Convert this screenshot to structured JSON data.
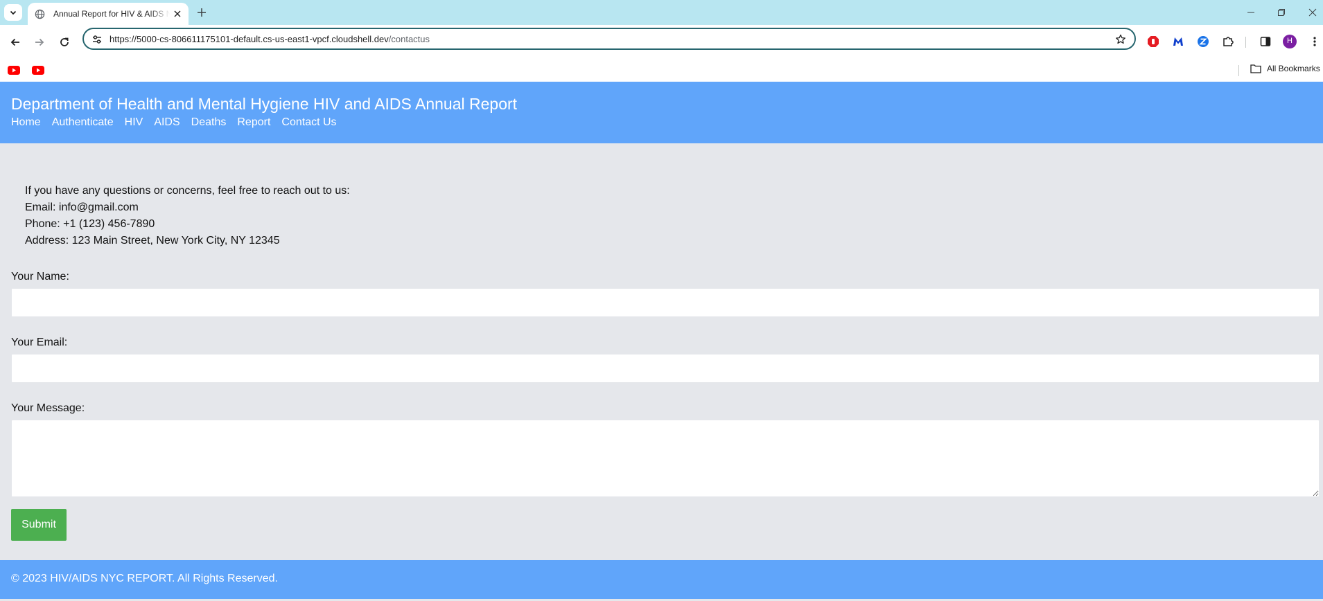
{
  "browser": {
    "tab_title": "Annual Report for HIV & AIDS NYC",
    "url_host": "https://5000-cs-806611175101-default.cs-us-east1-vpcf.cloudshell.dev",
    "url_path": "/contactus",
    "profile_initial": "H",
    "bookmarks_label": "All Bookmarks",
    "icons": {
      "tab_menu": "chevron-down-icon",
      "favicon": "globe-icon",
      "tab_close": "close-icon",
      "new_tab": "plus-icon",
      "back": "arrow-left-icon",
      "forward": "arrow-right-icon",
      "reload": "reload-icon",
      "site_info": "tune-icon",
      "bookmark": "star-icon",
      "extensions": [
        "adblock-icon",
        "malwarebytes-icon",
        "zoom-icon",
        "puzzle-icon"
      ],
      "side_panel": "side-panel-icon",
      "menu": "kebab-menu-icon",
      "bookmark_items": [
        "youtube-icon",
        "youtube-icon"
      ],
      "bookmarks_folder": "folder-icon"
    }
  },
  "site": {
    "title": "Department of Health and Mental Hygiene HIV and AIDS Annual Report",
    "nav": [
      "Home",
      "Authenticate",
      "HIV",
      "AIDS",
      "Deaths",
      "Report",
      "Contact Us"
    ],
    "colors": {
      "header": "#60a5fa",
      "background": "#e5e7eb",
      "submit": "#4caf50"
    }
  },
  "contact": {
    "intro": "If you have any questions or concerns, feel free to reach out to us:",
    "email": "Email: info@gmail.com",
    "phone": "Phone: +1 (123) 456-7890",
    "address": "Address: 123 Main Street, New York City, NY 12345"
  },
  "form": {
    "name_label": "Your Name:",
    "name_value": "",
    "email_label": "Your Email:",
    "email_value": "",
    "message_label": "Your Message:",
    "message_value": "",
    "submit_label": "Submit"
  },
  "footer": {
    "text": "© 2023 HIV/AIDS NYC REPORT. All Rights Reserved."
  }
}
